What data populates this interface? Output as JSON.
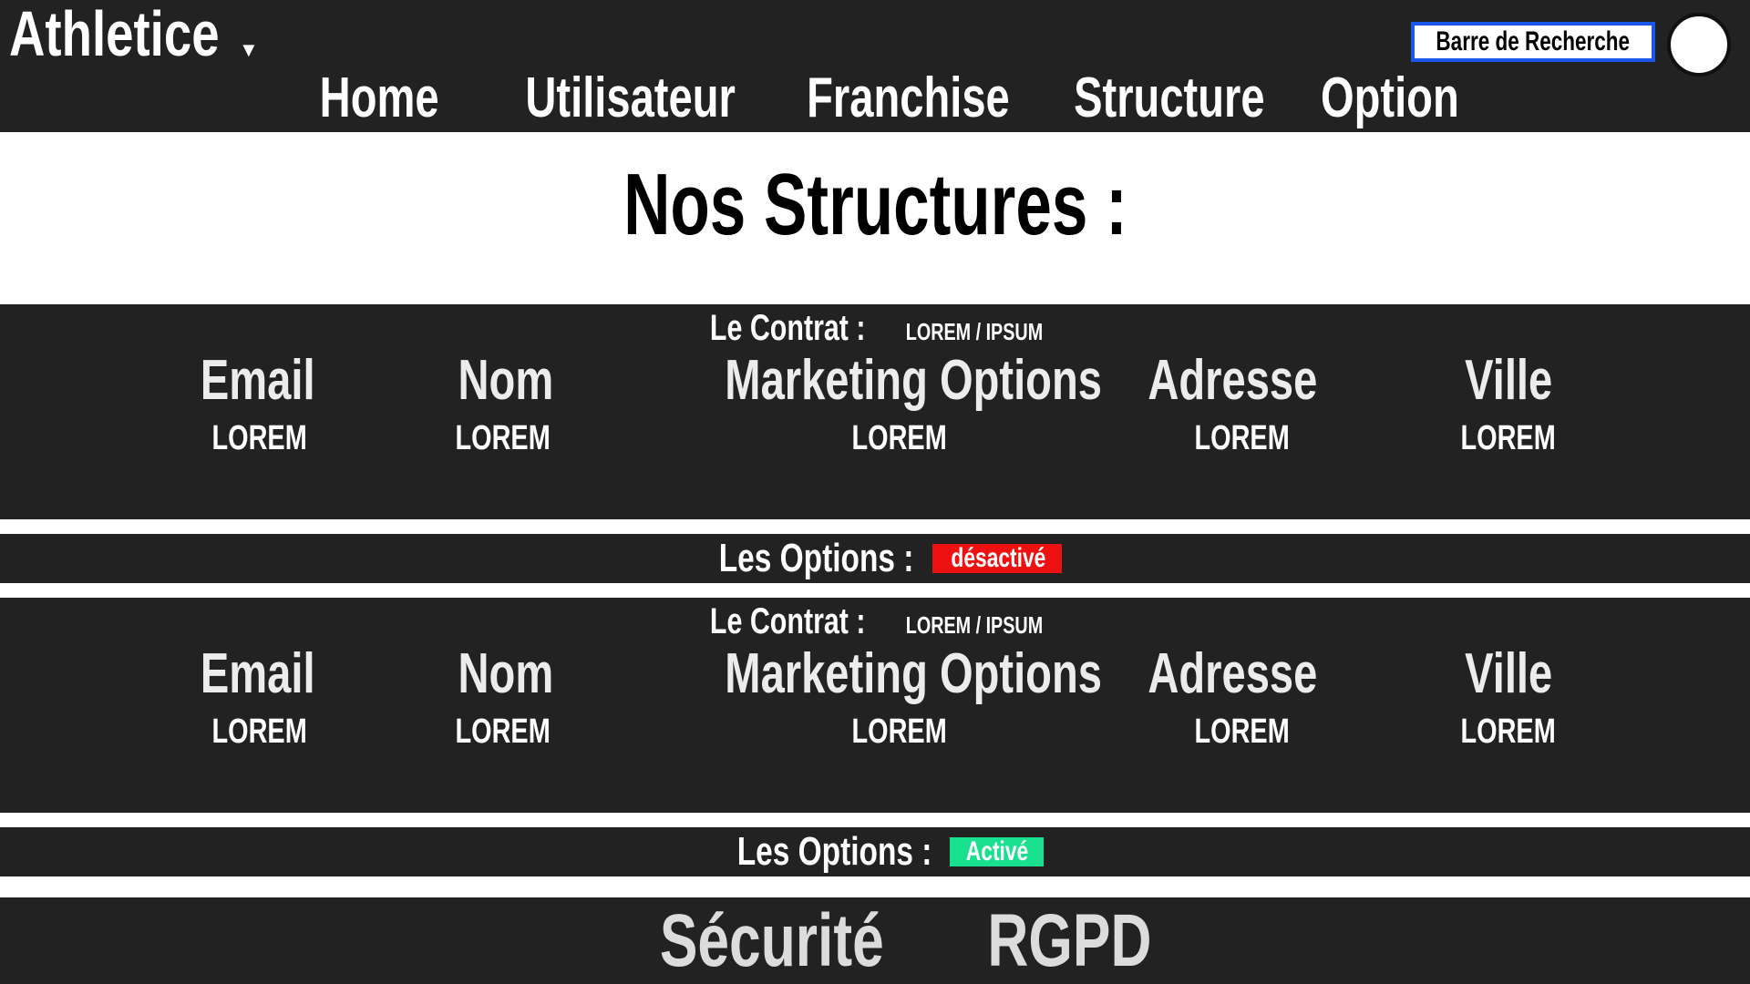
{
  "header": {
    "brand": "Athletice",
    "nav": [
      "Home",
      "Utilisateur",
      "Franchise",
      "Structure",
      "Option"
    ],
    "search_label": "Barre de Recherche"
  },
  "page": {
    "title": "Nos Structures :"
  },
  "structures": [
    {
      "contract_label": "Le Contrat :",
      "contract_value": "LOREM / IPSUM",
      "columns": [
        "Email",
        "Nom",
        "Marketing Options",
        "Adresse",
        "Ville"
      ],
      "values": [
        "LOREM",
        "LOREM",
        "LOREM",
        "LOREM",
        "LOREM"
      ],
      "options_label": "Les Options :",
      "options_status": "désactivé",
      "options_status_color": "#ee1111"
    },
    {
      "contract_label": "Le Contrat :",
      "contract_value": "LOREM / IPSUM",
      "columns": [
        "Email",
        "Nom",
        "Marketing Options",
        "Adresse",
        "Ville"
      ],
      "values": [
        "LOREM",
        "LOREM",
        "LOREM",
        "LOREM",
        "LOREM"
      ],
      "options_label": "Les Options :",
      "options_status": "Activé",
      "options_status_color": "#19e08f"
    }
  ],
  "footer": {
    "links": [
      "Sécurité",
      "RGPD"
    ]
  },
  "colors": {
    "dark_bar": "#222222",
    "search_border": "#1a56e8"
  }
}
